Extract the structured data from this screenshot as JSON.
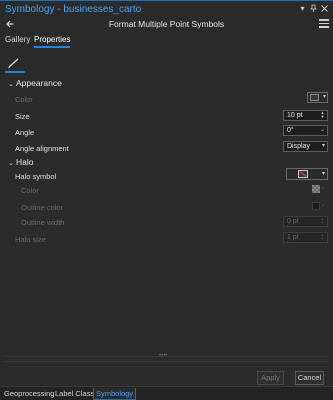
{
  "pane": {
    "title": "Symbology - businesses_carto",
    "subtitle": "Format Multiple Point Symbols"
  },
  "tabs": [
    {
      "label": "Gallery",
      "active": false
    },
    {
      "label": "Properties",
      "active": true
    }
  ],
  "appearance": {
    "header": "Appearance",
    "color_label": "Color",
    "size_label": "Size",
    "size_value": "10 pt",
    "angle_label": "Angle",
    "angle_value": "0°",
    "angle_alignment_label": "Angle alignment",
    "angle_alignment_value": "Display"
  },
  "halo": {
    "header": "Halo",
    "symbol_label": "Halo symbol",
    "color_label": "Color",
    "outline_color_label": "Outline color",
    "outline_width_label": "Outline width",
    "outline_width_value": "0 pt",
    "size_label": "Halo size",
    "size_value": "1 pt"
  },
  "buttons": {
    "apply": "Apply",
    "cancel": "Cancel"
  },
  "bottom_tabs": [
    {
      "label": "Geoprocessing"
    },
    {
      "label": "Label Class"
    },
    {
      "label": "Symbology",
      "active": true
    }
  ],
  "colors": {
    "accent": "#1f86e0",
    "title": "#4aa3f0",
    "background": "#2b2b2b"
  },
  "icons": {
    "back": "back-arrow-icon",
    "menu": "hamburger-menu-icon",
    "brush": "brush-icon",
    "close": "close-icon",
    "pin": "pin-icon",
    "dropdown": "dropdown-arrow-icon"
  }
}
